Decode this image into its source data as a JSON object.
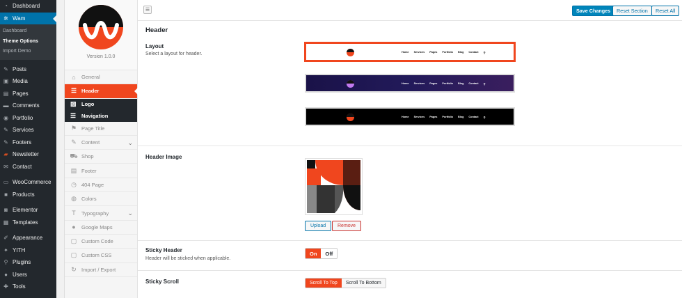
{
  "wp_menu": {
    "top": [
      {
        "label": "Dashboard",
        "icon": "dashboard-icon"
      },
      {
        "label": "Wam",
        "icon": "gear-icon"
      }
    ],
    "sub": [
      {
        "label": "Dashboard"
      },
      {
        "label": "Theme Options"
      },
      {
        "label": "Import Demo"
      }
    ],
    "items": [
      {
        "label": "Posts",
        "icon": "pin-icon"
      },
      {
        "label": "Media",
        "icon": "media-icon"
      },
      {
        "label": "Pages",
        "icon": "pages-icon"
      },
      {
        "label": "Comments",
        "icon": "comments-icon"
      },
      {
        "label": "Portfolio",
        "icon": "portfolio-icon"
      },
      {
        "label": "Services",
        "icon": "services-icon"
      },
      {
        "label": "Footers",
        "icon": "footers-icon"
      },
      {
        "label": "Newsletter",
        "icon": "newsletter-icon"
      },
      {
        "label": "Contact",
        "icon": "mail-icon"
      },
      {
        "label": "WooCommerce",
        "icon": "woocommerce-icon"
      },
      {
        "label": "Products",
        "icon": "products-icon"
      },
      {
        "label": "Elementor",
        "icon": "elementor-icon"
      },
      {
        "label": "Templates",
        "icon": "templates-icon"
      },
      {
        "label": "Appearance",
        "icon": "appearance-icon"
      },
      {
        "label": "YITH",
        "icon": "yith-icon"
      },
      {
        "label": "Plugins",
        "icon": "plugins-icon"
      },
      {
        "label": "Users",
        "icon": "users-icon"
      },
      {
        "label": "Tools",
        "icon": "tools-icon"
      }
    ]
  },
  "options_nav": {
    "version": "Version 1.0.0",
    "items": [
      {
        "label": "General",
        "icon": "home-icon"
      },
      {
        "label": "Header",
        "icon": "header-icon"
      },
      {
        "label": "Logo",
        "icon": "image-icon"
      },
      {
        "label": "Navigation",
        "icon": "menu-icon"
      },
      {
        "label": "Page Title",
        "icon": "map-pin-icon"
      },
      {
        "label": "Content",
        "icon": "pencil-icon"
      },
      {
        "label": "Shop",
        "icon": "cart-icon"
      },
      {
        "label": "Footer",
        "icon": "footer-icon"
      },
      {
        "label": "404 Page",
        "icon": "clock-icon"
      },
      {
        "label": "Colors",
        "icon": "palette-icon"
      },
      {
        "label": "Typography",
        "icon": "typography-icon"
      },
      {
        "label": "Google Maps",
        "icon": "location-icon"
      },
      {
        "label": "Custom Code",
        "icon": "code-icon"
      },
      {
        "label": "Custom CSS",
        "icon": "css-icon"
      },
      {
        "label": "Import / Export",
        "icon": "refresh-icon"
      }
    ]
  },
  "toolbar": {
    "save_label": "Save Changes",
    "reset_section_label": "Reset Section",
    "reset_all_label": "Reset All"
  },
  "section": {
    "title": "Header",
    "layout": {
      "label": "Layout",
      "desc": "Select a layout for header.",
      "nav_items": [
        "Home",
        "Services",
        "Pages",
        "Portfolio",
        "Blog",
        "Contact"
      ]
    },
    "header_image": {
      "label": "Header Image",
      "upload_label": "Upload",
      "remove_label": "Remove"
    },
    "sticky_header": {
      "label": "Sticky Header",
      "desc": "Header will be sticked when applicable.",
      "on": "On",
      "off": "Off"
    },
    "sticky_scroll": {
      "label": "Sticky Scroll",
      "top": "Scroll To Top",
      "bottom": "Scroll To Bottom"
    }
  },
  "colors": {
    "accent": "#f0461e",
    "wp_blue": "#0073aa",
    "sidebar": "#23282d"
  }
}
